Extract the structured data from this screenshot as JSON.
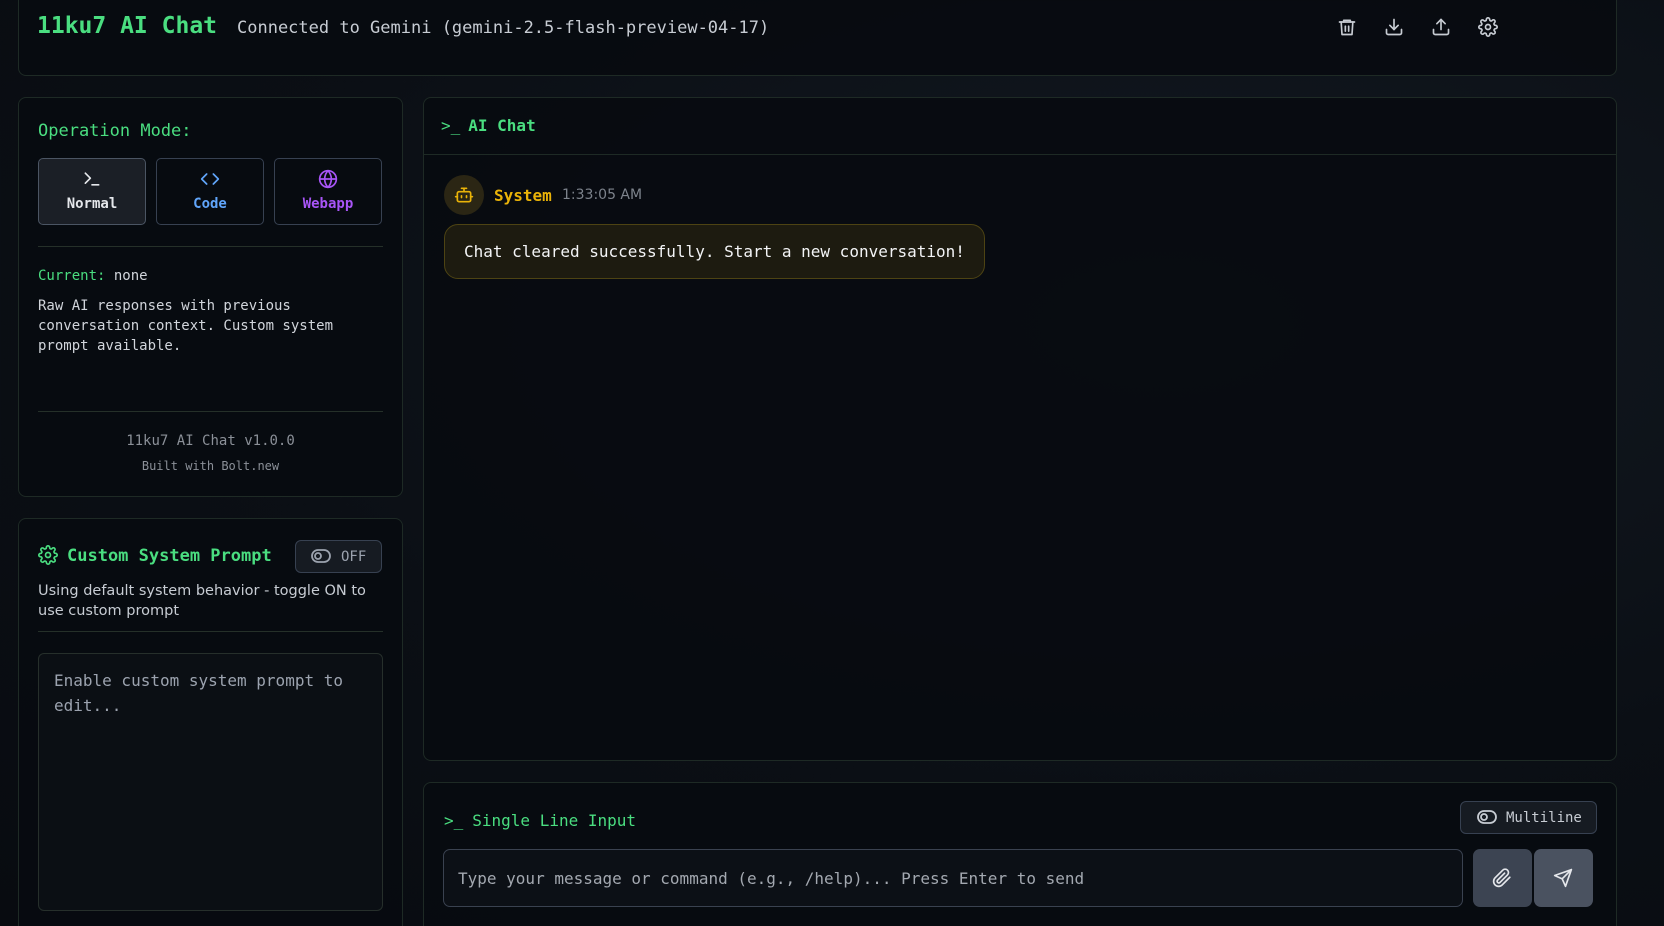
{
  "header": {
    "title": "11ku7 AI Chat",
    "connection": "Connected to Gemini (gemini-2.5-flash-preview-04-17)",
    "actions": [
      "trash-icon",
      "download-icon",
      "upload-icon",
      "gear-icon"
    ]
  },
  "mode_panel": {
    "label": "Operation Mode:",
    "modes": [
      {
        "label": "Normal",
        "icon": "terminal-icon",
        "color": "#e5e7eb",
        "active": true
      },
      {
        "label": "Code",
        "icon": "code-icon",
        "color": "#60a5fa",
        "active": false
      },
      {
        "label": "Webapp",
        "icon": "globe-icon",
        "color": "#a855f7",
        "active": false
      }
    ],
    "current_key": "Current:",
    "current_value": "none",
    "description": "Raw AI responses with previous conversation context. Custom system prompt available.",
    "version": "11ku7 AI Chat v1.0.0",
    "built_with": "Built with Bolt.new"
  },
  "custom_prompt": {
    "title": "Custom System Prompt",
    "toggle_label": "OFF",
    "description": "Using default system behavior - toggle ON to use custom prompt",
    "placeholder": "Enable custom system prompt to edit..."
  },
  "chat": {
    "prompt_symbol": ">_",
    "title": "AI Chat",
    "messages": [
      {
        "sender": "System",
        "time": "1:33:05 AM",
        "text": "Chat cleared successfully. Start a new conversation!"
      }
    ]
  },
  "input": {
    "prompt_symbol": ">_",
    "mode_label": "Single Line Input",
    "multiline_label": "Multiline",
    "placeholder": "Type your message or command (e.g., /help)... Press Enter to send"
  },
  "colors": {
    "accent": "#4ade80",
    "system": "#eab308",
    "code": "#60a5fa",
    "webapp": "#a855f7"
  }
}
